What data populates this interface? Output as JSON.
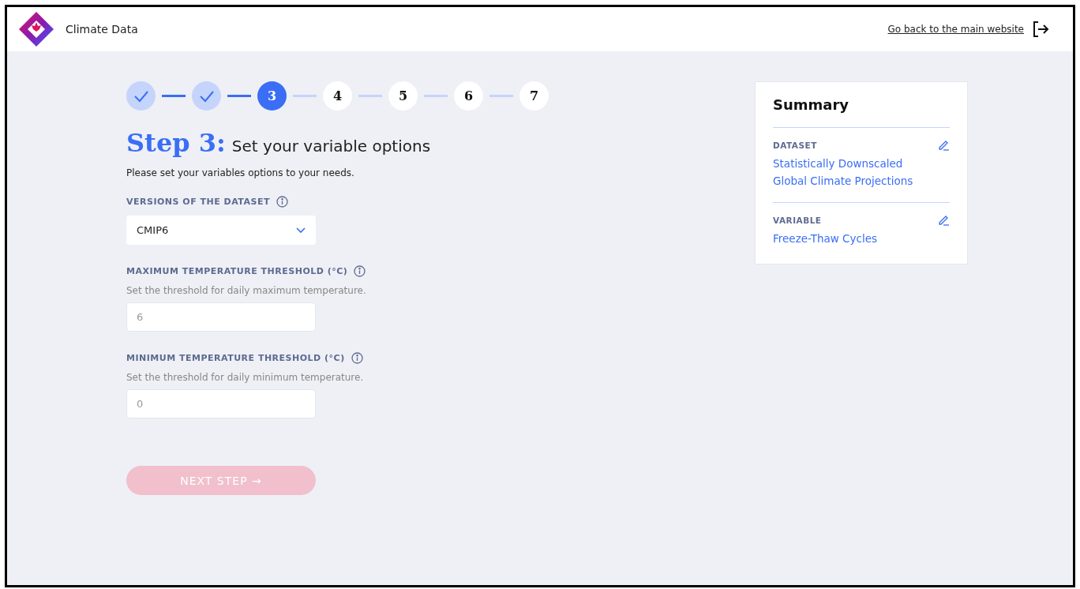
{
  "header": {
    "title": "Climate Data",
    "back_link": "Go back to the main website"
  },
  "steps": [
    {
      "completed": true,
      "selected": false
    },
    {
      "completed": true,
      "selected": false
    },
    {
      "completed": false,
      "selected": true,
      "label": "3"
    },
    {
      "completed": false,
      "selected": false,
      "label": "4"
    },
    {
      "completed": false,
      "selected": false,
      "label": "5"
    },
    {
      "completed": false,
      "selected": false,
      "label": "6"
    },
    {
      "completed": false,
      "selected": false,
      "label": "7"
    }
  ],
  "heading": {
    "step": "Step 3:",
    "title": "Set your variable options"
  },
  "intro": "Please set your variables options to your needs.",
  "fields": [
    {
      "kind": "select",
      "label": "VERSIONS OF THE DATASET",
      "value": "CMIP6"
    },
    {
      "kind": "number",
      "label": "MAXIMUM TEMPERATURE THRESHOLD (°C)",
      "help": "Set the threshold for daily maximum temperature.",
      "placeholder": "6"
    },
    {
      "kind": "number",
      "label": "MINIMUM TEMPERATURE THRESHOLD (°C)",
      "help": "Set the threshold for daily minimum temperature.",
      "placeholder": "0"
    }
  ],
  "next_button": {
    "label": "NEXT STEP →",
    "disabled": true
  },
  "summary": {
    "title": "Summary",
    "items": [
      {
        "label": "DATASET",
        "value": "Statistically Downscaled Global Climate Projections"
      },
      {
        "label": "VARIABLE",
        "value": "Freeze-Thaw Cycles"
      }
    ]
  }
}
